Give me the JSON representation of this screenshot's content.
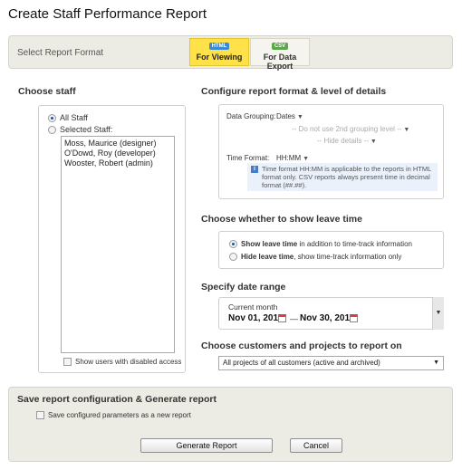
{
  "page": {
    "title": "Create Staff Performance Report"
  },
  "format": {
    "label": "Select Report Format",
    "options": [
      {
        "badge": "HTML",
        "label": "For Viewing",
        "selected": true
      },
      {
        "badge": "CSV",
        "label": "For Data Export",
        "selected": false
      }
    ]
  },
  "staff": {
    "heading": "Choose staff",
    "all_label": "All Staff",
    "selected_label": "Selected Staff:",
    "members": [
      "Moss, Maurice (designer)",
      "O'Dowd, Roy (developer)",
      "Wooster, Robert (admin)"
    ],
    "disabled_label": "Show users with disabled access"
  },
  "config": {
    "heading": "Configure report format & level of details",
    "grouping_label": "Data Grouping:",
    "grouping_value": "Dates",
    "second_level": "-- Do not use 2nd grouping level --",
    "hide_details": "-- Hide details --",
    "time_label": "Time Format:",
    "time_value": "HH:MM",
    "info": "Time format HH:MM is applicable to the reports in HTML format only. CSV reports always present time in decimal format (##.##)."
  },
  "leave": {
    "heading": "Choose whether to show leave time",
    "show_bold": "Show leave time",
    "show_rest": " in addition to time-track information",
    "hide_bold": "Hide leave time",
    "hide_rest": ", show time-track information only"
  },
  "date": {
    "heading": "Specify date range",
    "preset": "Current month",
    "from": "Nov 01, 2011",
    "sep": "—",
    "to": "Nov 30, 2011"
  },
  "customers": {
    "heading": "Choose customers and projects to report on",
    "selected": "All projects of all customers (active and archived)"
  },
  "save": {
    "heading": "Save report configuration & Generate report",
    "checkbox_label": "Save configured parameters as a new report",
    "generate_label": "Generate Report",
    "cancel_label": "Cancel"
  },
  "colors": {
    "viewing_bg": "#ffe24a",
    "html_badge": "#3a8ad4",
    "csv_badge": "#5aa84a",
    "panel_bg": "#ecebe4"
  }
}
